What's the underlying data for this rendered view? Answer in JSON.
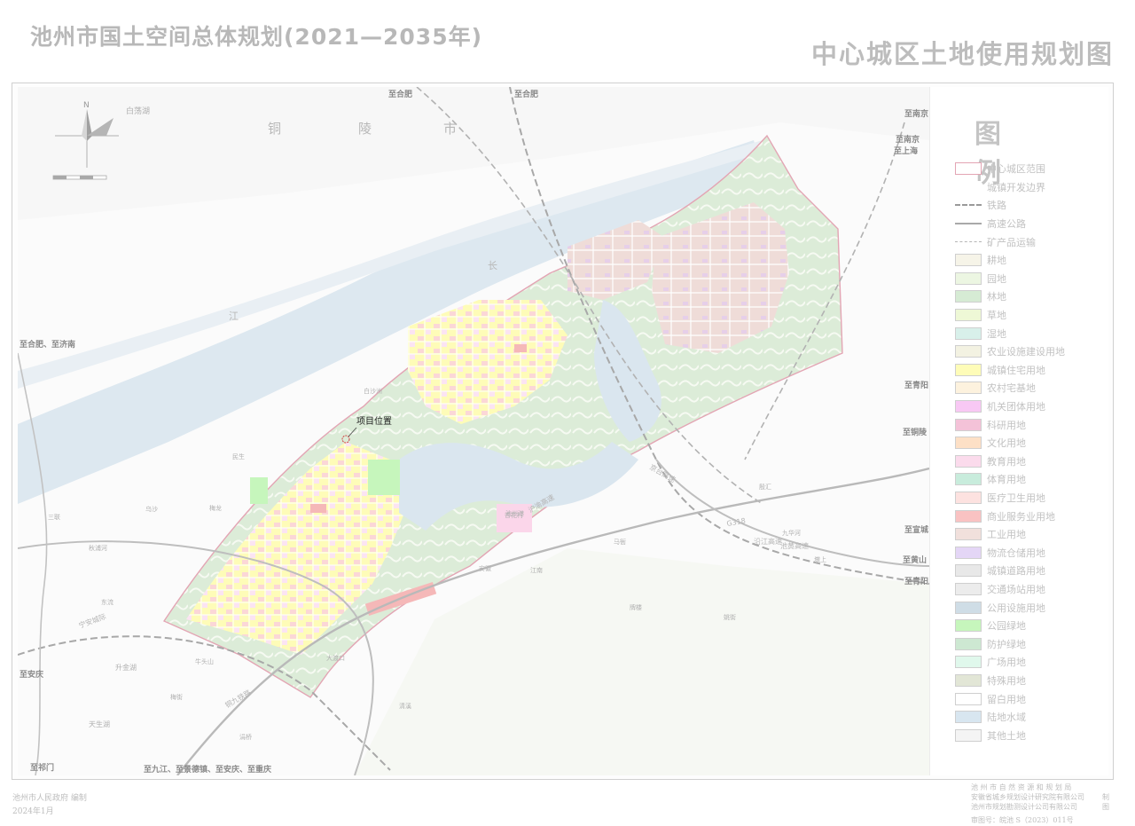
{
  "header": {
    "main_title": "池州市国土空间总体规划(2021—2035年)",
    "map_title": "中心城区土地使用规划图"
  },
  "map": {
    "north_label": "N",
    "project_label": "项目位置",
    "place_labels": [
      "铜",
      "陵",
      "市",
      "白荡湖",
      "长",
      "江",
      "至合肥",
      "至合肥",
      "至南京",
      "至南京",
      "至上海",
      "至合肥、至济南",
      "至安庆",
      "至祁门",
      "至九江、至景德镇、至安庆、至重庆",
      "至青阳",
      "至铜陵",
      "至宣城",
      "至黄山",
      "至青阳",
      "白沙洲",
      "民生",
      "梅龙",
      "三联",
      "乌沙",
      "东流",
      "牛头山",
      "秋浦河",
      "升金湖",
      "天生湖",
      "马衙",
      "杏花村",
      "殷汇",
      "梅街",
      "墩上",
      "九华河",
      "江南",
      "大渡口",
      "清溪",
      "安徽",
      "池州港",
      "姚街",
      "涓桥",
      "牌楼"
    ],
    "road_labels": [
      "沪渝高速",
      "京台高速",
      "沿江高速",
      "池黄高速",
      "铜九铁路",
      "宁安城际",
      "G318"
    ]
  },
  "legend": {
    "title": "图例",
    "items": [
      {
        "label": "中心城区范围",
        "color": "#ffffff",
        "kind": "boundary"
      },
      {
        "label": "城镇开发边界",
        "color": "#ffffff",
        "kind": "none"
      },
      {
        "label": "铁路",
        "color": "#9a9a9a",
        "kind": "rail"
      },
      {
        "label": "高速公路",
        "color": "#a9a9a9",
        "kind": "highway"
      },
      {
        "label": "矿产品运输",
        "color": "#b5b5b5",
        "kind": "dashed"
      },
      {
        "label": "耕地",
        "color": "#f6f4e8",
        "kind": "fill"
      },
      {
        "label": "园地",
        "color": "#ecf6e2",
        "kind": "fill"
      },
      {
        "label": "林地",
        "color": "#d6ebd4",
        "kind": "fill"
      },
      {
        "label": "草地",
        "color": "#eef8d6",
        "kind": "fill"
      },
      {
        "label": "湿地",
        "color": "#d8f0ea",
        "kind": "fill"
      },
      {
        "label": "农业设施建设用地",
        "color": "#f3f2e2",
        "kind": "fill"
      },
      {
        "label": "城镇住宅用地",
        "color": "#fefcb8",
        "kind": "fill"
      },
      {
        "label": "农村宅基地",
        "color": "#fdf2de",
        "kind": "fill"
      },
      {
        "label": "机关团体用地",
        "color": "#f8c8f4",
        "kind": "fill"
      },
      {
        "label": "科研用地",
        "color": "#f4c2d8",
        "kind": "fill"
      },
      {
        "label": "文化用地",
        "color": "#fde0c6",
        "kind": "fill"
      },
      {
        "label": "教育用地",
        "color": "#fbdbec",
        "kind": "fill"
      },
      {
        "label": "体育用地",
        "color": "#c8ecdc",
        "kind": "fill"
      },
      {
        "label": "医疗卫生用地",
        "color": "#fde2e0",
        "kind": "fill"
      },
      {
        "label": "商业服务业用地",
        "color": "#f9c2c2",
        "kind": "fill"
      },
      {
        "label": "工业用地",
        "color": "#f1e0dc",
        "kind": "fill"
      },
      {
        "label": "物流仓储用地",
        "color": "#e4d6f6",
        "kind": "fill"
      },
      {
        "label": "城镇道路用地",
        "color": "#e8e8e8",
        "kind": "fill"
      },
      {
        "label": "交通场站用地",
        "color": "#ececec",
        "kind": "fill"
      },
      {
        "label": "公用设施用地",
        "color": "#cfdde6",
        "kind": "fill"
      },
      {
        "label": "公园绿地",
        "color": "#c6f6bc",
        "kind": "fill"
      },
      {
        "label": "防护绿地",
        "color": "#cde8d2",
        "kind": "fill"
      },
      {
        "label": "广场用地",
        "color": "#e0f8ec",
        "kind": "fill"
      },
      {
        "label": "特殊用地",
        "color": "#e2e6d6",
        "kind": "fill"
      },
      {
        "label": "留白用地",
        "color": "#ffffff",
        "kind": "fill"
      },
      {
        "label": "陆地水域",
        "color": "#d8e6f0",
        "kind": "fill"
      },
      {
        "label": "其他土地",
        "color": "#f4f4f4",
        "kind": "fill"
      }
    ]
  },
  "footer": {
    "left_org": "池州市人民政府   编制",
    "left_date": "2024年1月",
    "right_org1": "池 州 市 自 然 资 源 和 规 划 局",
    "right_org2": "安徽省城乡规划设计研究院有限公司",
    "right_org3": "池州市规划勘测设计公司有限公司",
    "made": "制图",
    "approval": "审图号：皖池 S（2023）011号"
  },
  "colors": {
    "title_gray": "#b8b8b8",
    "river": "#d9e7f0",
    "boundary": "#e3a5b4",
    "residential": "#fefcb8",
    "industrial": "#f1e0dc",
    "commercial": "#f9c2c2",
    "forest": "#d6ebd4"
  }
}
